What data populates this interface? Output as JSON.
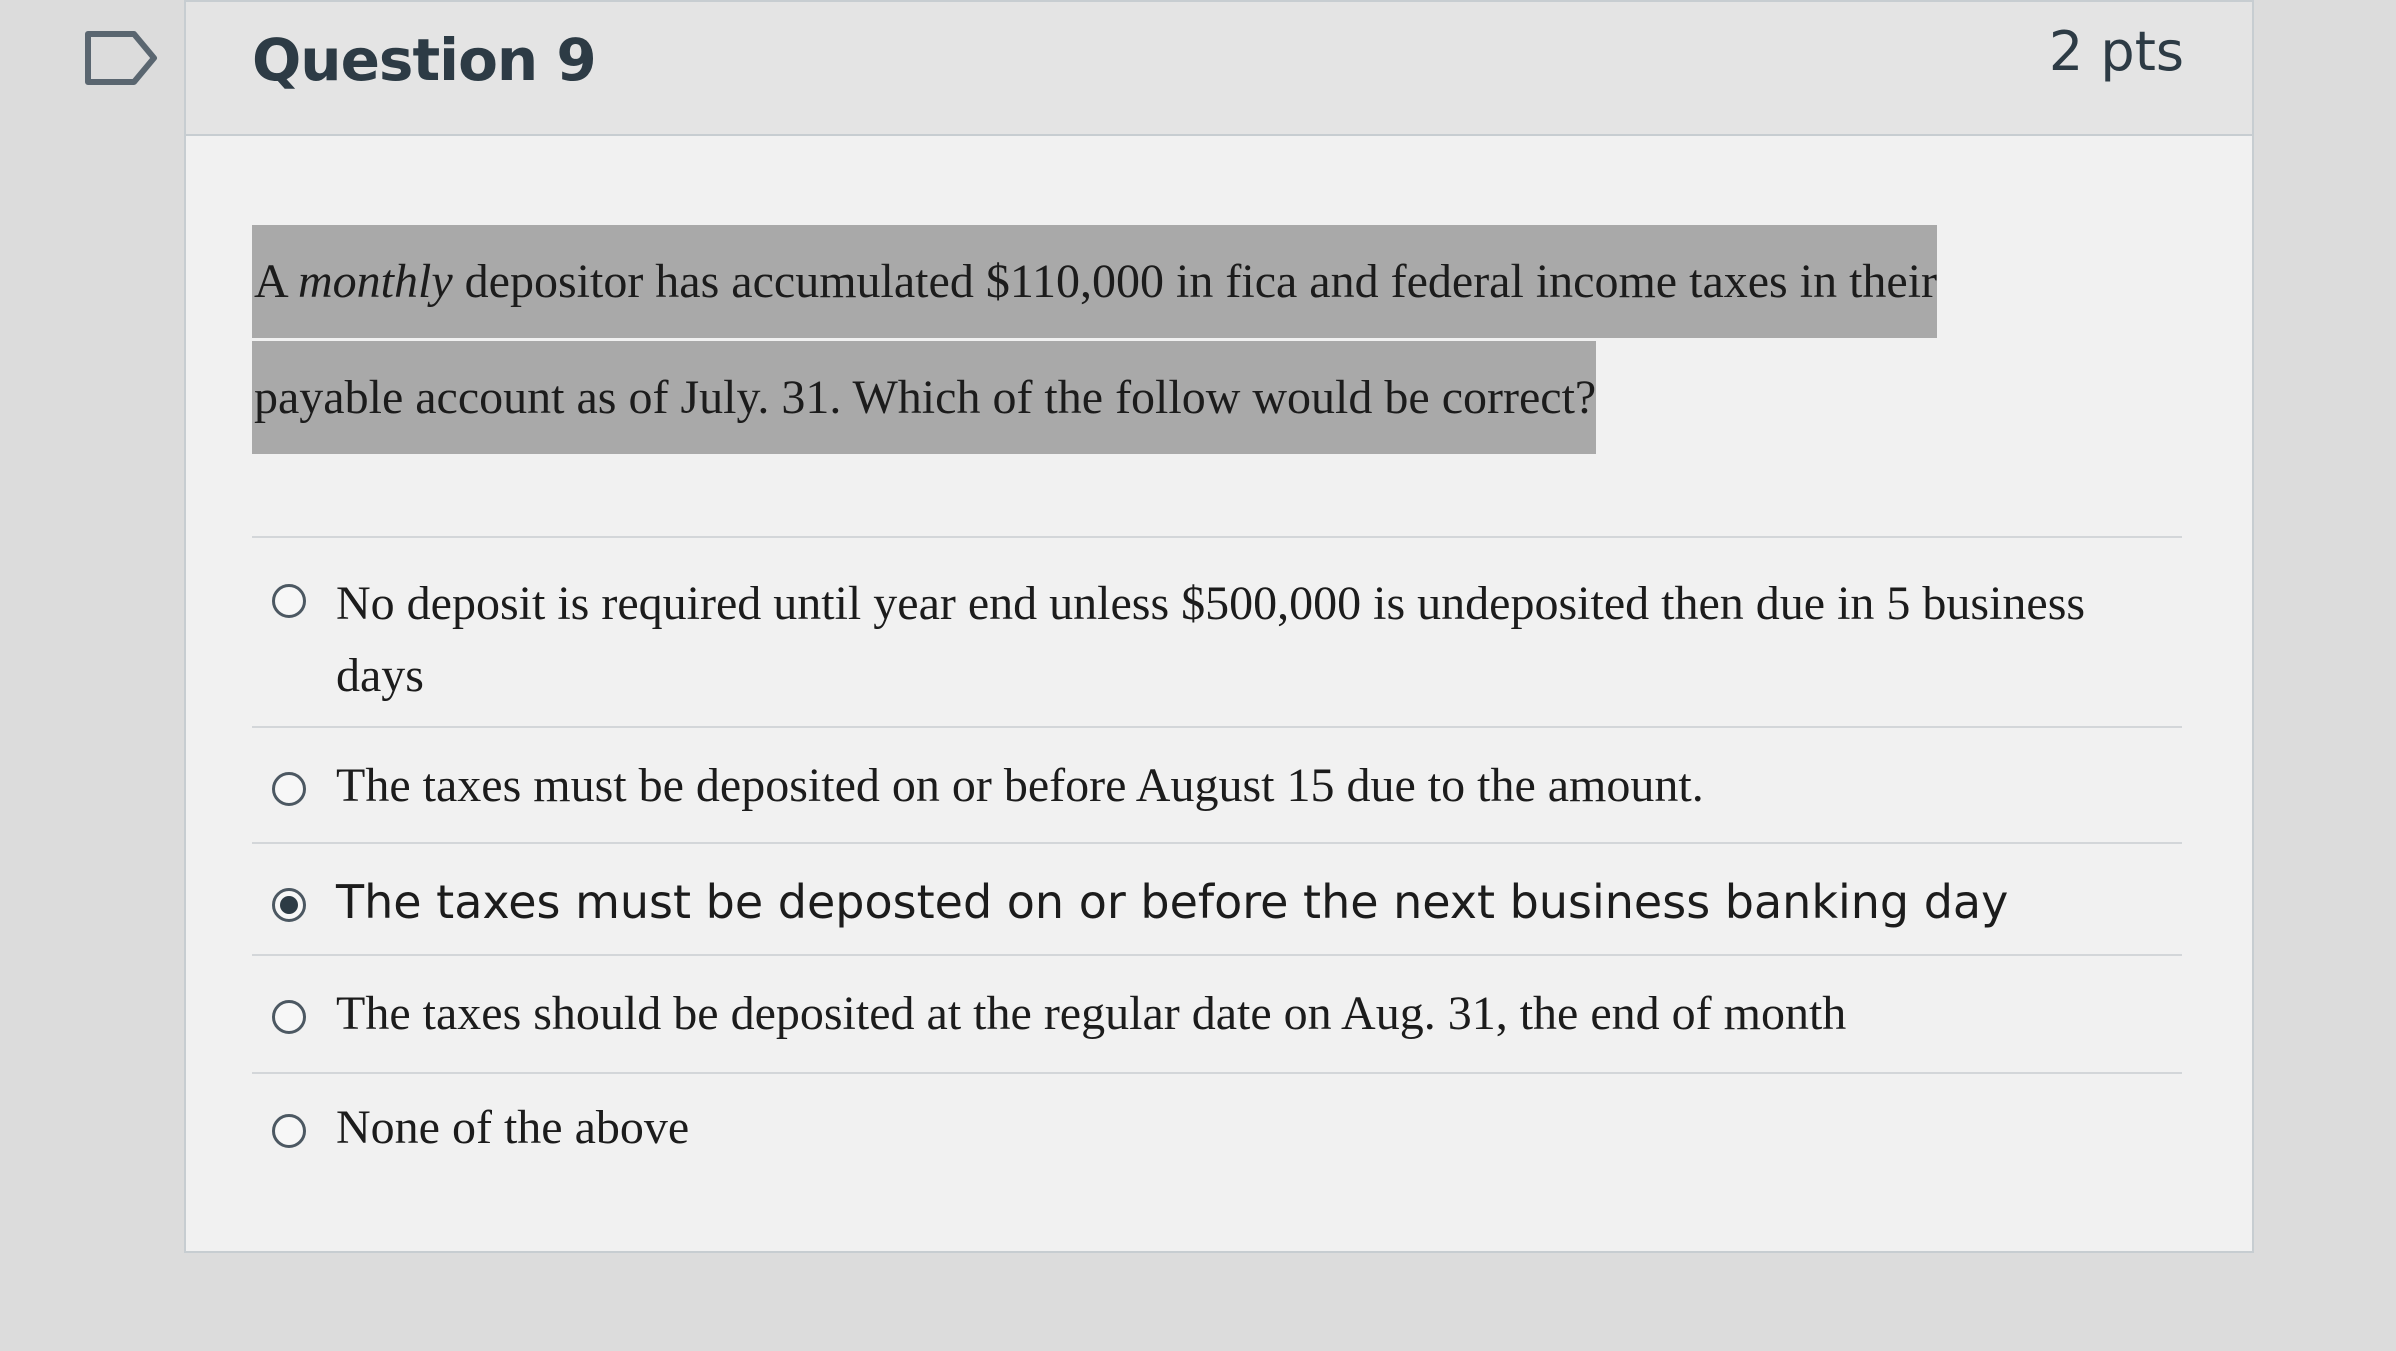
{
  "question": {
    "title": "Question 9",
    "points": "2 pts",
    "text_parts": [
      "A ",
      "monthly",
      " depositor has accumulated $110,000 in fica and federal income taxes in their payable account as of July. 31.  Which of the follow would be correct?"
    ]
  },
  "answers": [
    {
      "label": "No deposit is required until year end unless $500,000 is undeposited then due in 5 business days",
      "selected": false
    },
    {
      "label": "The taxes must be deposited on or before August 15 due to the amount.",
      "selected": false
    },
    {
      "label": "The taxes must be deposted on or before the next business banking day",
      "selected": true
    },
    {
      "label": "The taxes should be deposited at the regular date on Aug. 31, the end of month",
      "selected": false
    },
    {
      "label": "None of the above",
      "selected": false
    }
  ]
}
